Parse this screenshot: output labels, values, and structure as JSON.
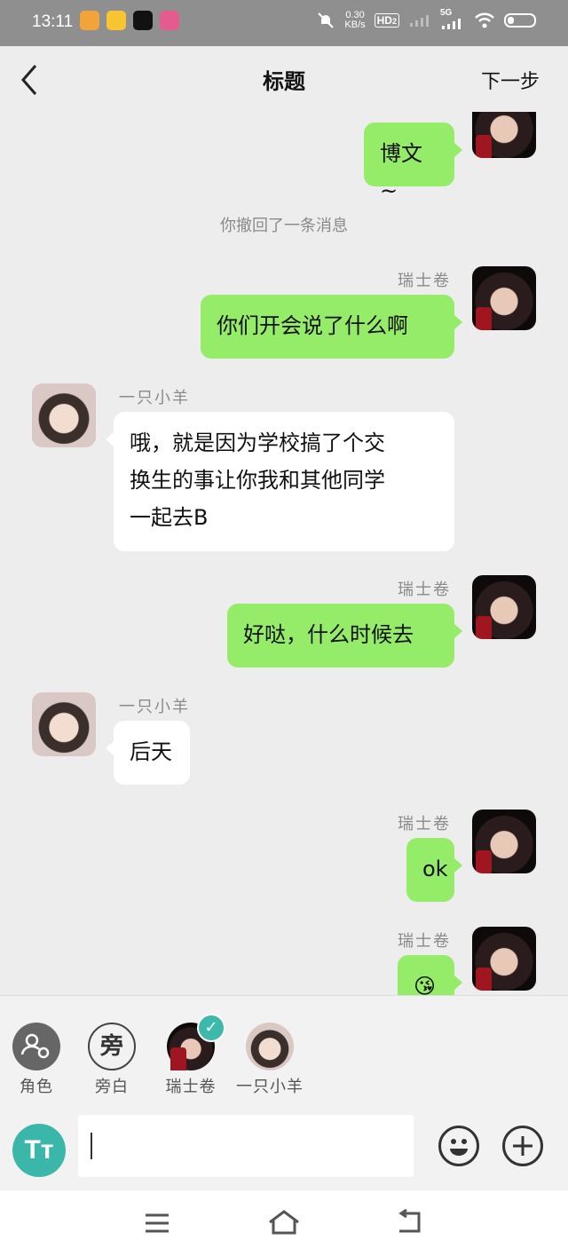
{
  "status_bar": {
    "time": "13:11",
    "network_speed": "0.30\nKB/s",
    "network_speed_top": "0.30",
    "network_speed_bottom": "KB/s",
    "hd_label": "HD",
    "hd_sub": "2",
    "signal_label": "5G",
    "battery_level": 0.2
  },
  "header": {
    "title": "标题",
    "next_label": "下一步"
  },
  "messages": [
    {
      "side": "right",
      "name": "",
      "text": "博文~"
    },
    {
      "system": "你撤回了一条消息"
    },
    {
      "side": "right",
      "name": "瑞士卷",
      "text": "你们开会说了什么啊"
    },
    {
      "side": "left",
      "name": "一只小羊",
      "line1": "哦，就是因为学校搞了个交",
      "line2": "换生的事让你我和其他同学",
      "line3": "一起去B"
    },
    {
      "side": "right",
      "name": "瑞士卷",
      "text": "好哒，什么时候去"
    },
    {
      "side": "left",
      "name": "一只小羊",
      "text": "后天"
    },
    {
      "side": "right",
      "name": "瑞士卷",
      "text": "ok"
    },
    {
      "side": "right",
      "name": "瑞士卷",
      "text": "😘"
    }
  ],
  "roles": [
    {
      "label": "角色",
      "icon": "role-settings-icon"
    },
    {
      "label": "旁白",
      "glyph": "旁"
    },
    {
      "label": "瑞士卷",
      "selected": true
    },
    {
      "label": "一只小羊",
      "selected": false
    }
  ],
  "composer": {
    "font_button": "Tт",
    "input_value": ""
  },
  "colors": {
    "green_bubble": "#95ec69",
    "accent": "#3bb7aa",
    "background": "#ededed"
  }
}
